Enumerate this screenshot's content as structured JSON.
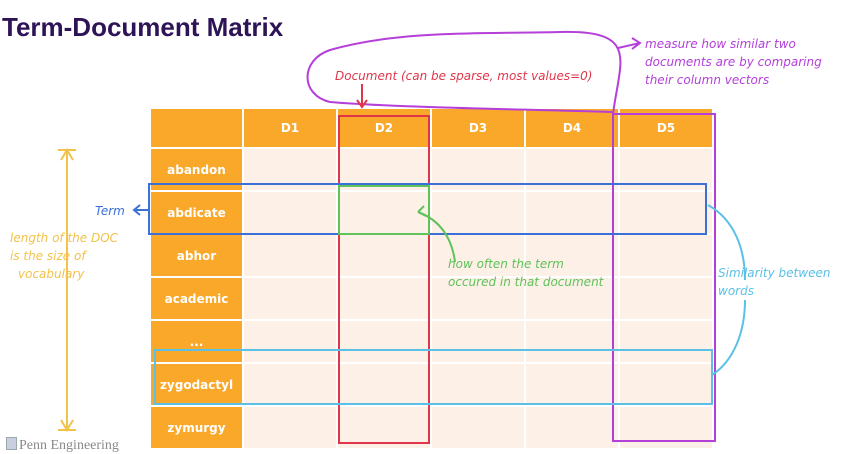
{
  "title": "Term-Document Matrix",
  "matrix": {
    "columns": [
      "D1",
      "D2",
      "D3",
      "D4",
      "D5"
    ],
    "rows": [
      "abandon",
      "abdicate",
      "abhor",
      "academic",
      "...",
      "zygodactyl",
      "zymurgy"
    ]
  },
  "annotations": {
    "document": "Document (can be sparse, most values=0)",
    "measure_line1": "measure how similar two",
    "measure_line2": "documents are by comparing",
    "measure_line3": "their column vectors",
    "term": "Term",
    "length_line1": "length of the DOC",
    "length_line2": "is the size of",
    "length_line3": "vocabulary",
    "how_often_line1": "how often the term",
    "how_often_line2": "occured in that document",
    "similarity_line1": "Similarity between",
    "similarity_line2": "words"
  },
  "colors": {
    "header": "#f9a82a",
    "cell": "#fdf0e7",
    "title": "#2e1457",
    "purple": "#b43fd9",
    "red": "#e0364a",
    "blue": "#3c6fd8",
    "green": "#5fc25a",
    "lightblue": "#5bc0e6",
    "yellow": "#f2c24a"
  },
  "logo": "Penn Engineering"
}
